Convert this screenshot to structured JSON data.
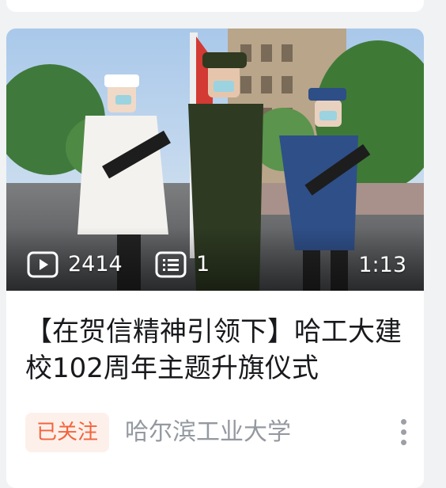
{
  "video_card": {
    "title": "【在贺信精神引领下】哈工大建校102周年主题升旗仪式",
    "play_count": "2414",
    "danmaku_count": "1",
    "duration": "1:13",
    "follow_badge": "已关注",
    "uploader": "哈尔滨工业大学",
    "icons": {
      "play": "play-icon",
      "danmaku": "danmaku-icon",
      "more": "more-vertical-icon"
    },
    "colors": {
      "badge_text": "#f2643c",
      "badge_background": "#fdf0ea",
      "uploader_text": "#9499a0",
      "title_text": "#18191c"
    }
  }
}
